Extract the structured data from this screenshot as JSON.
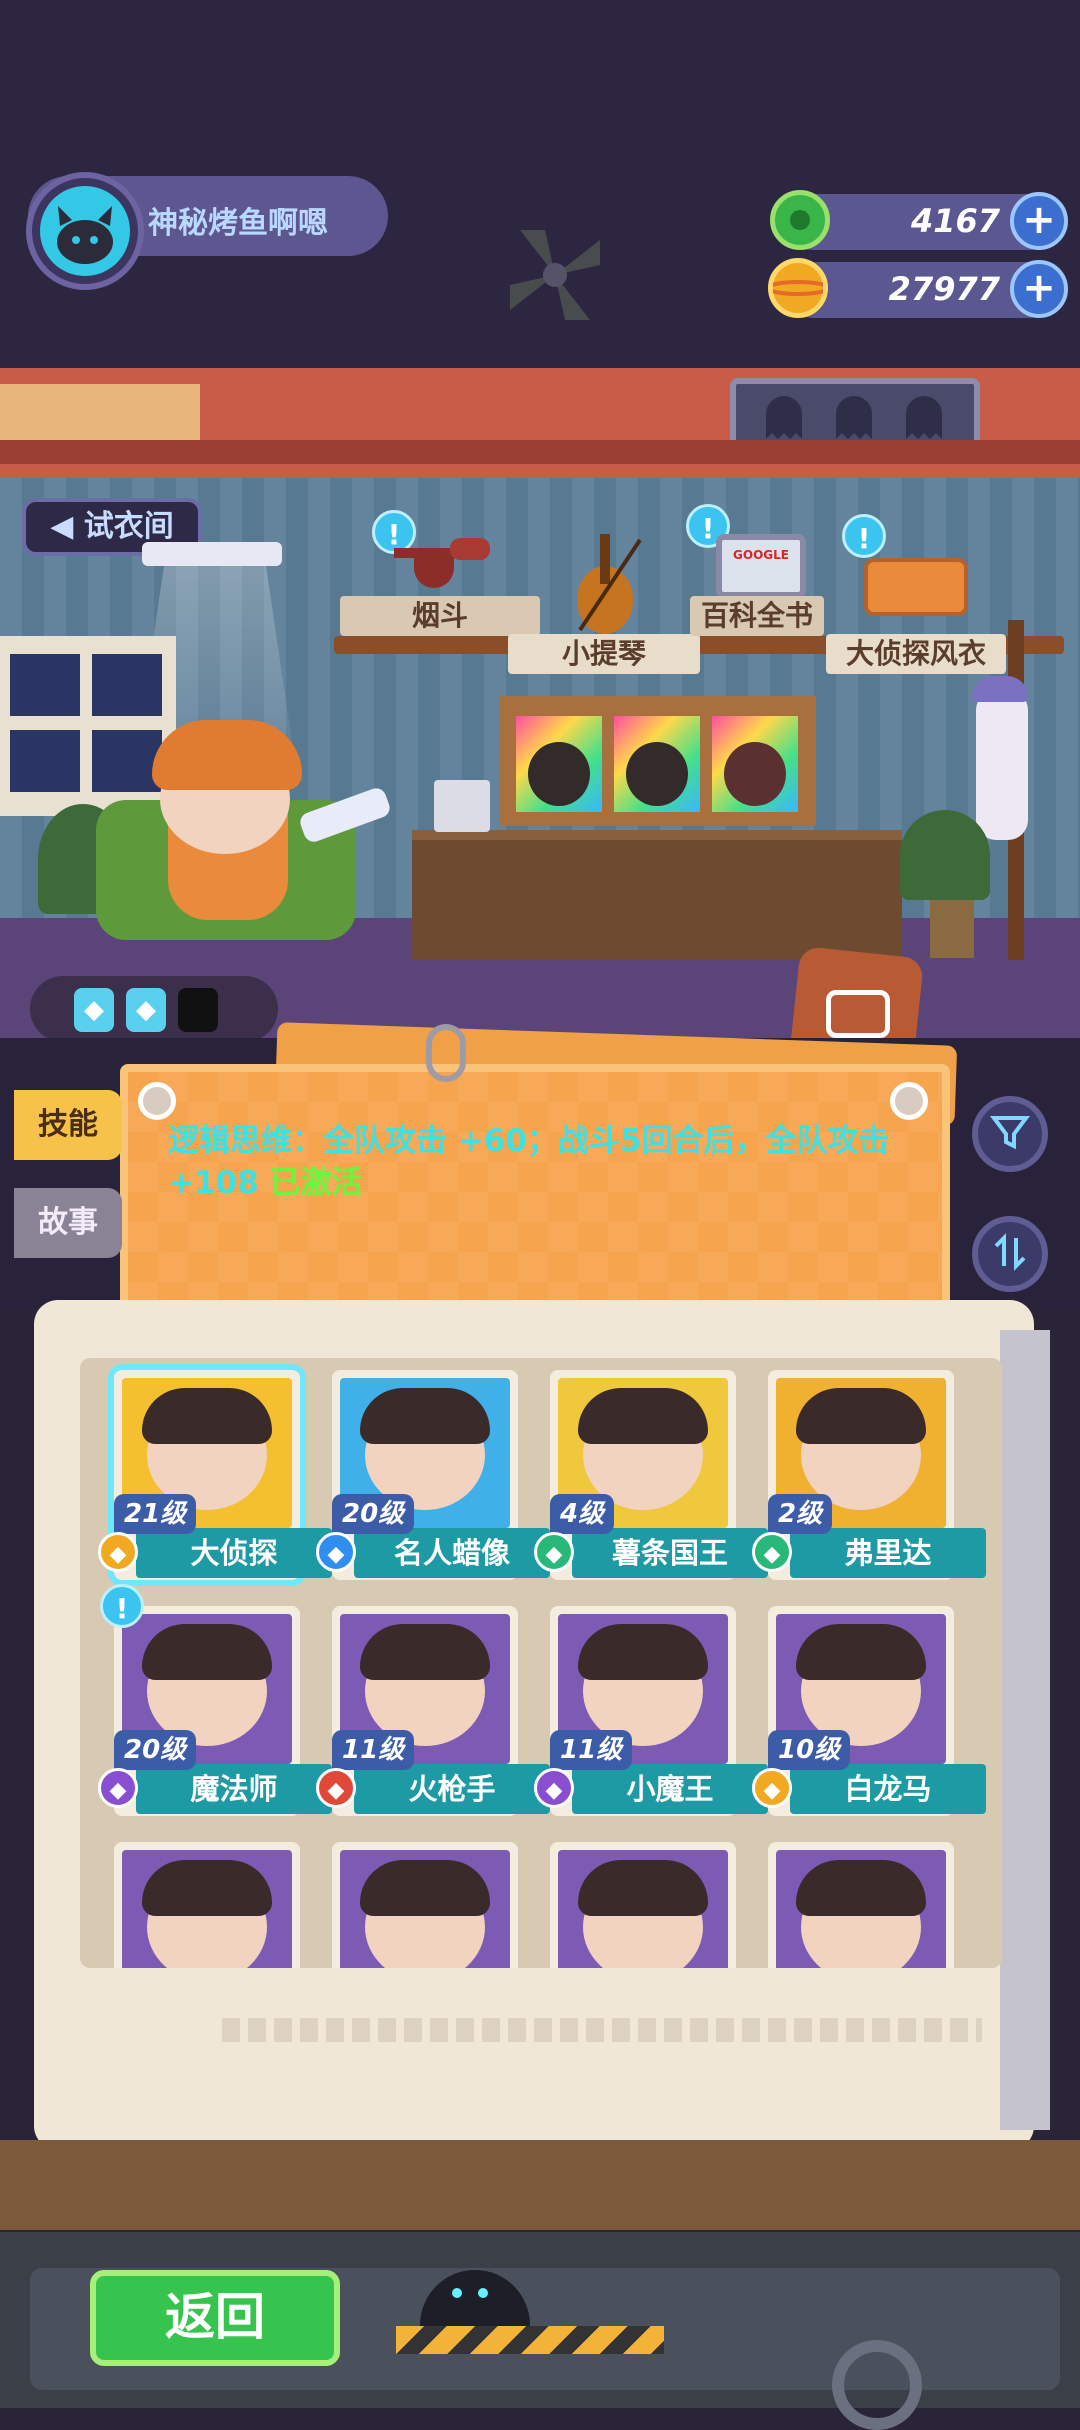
{
  "player": {
    "name": "神秘烤鱼啊嗯"
  },
  "resources": [
    {
      "icon": "green-coin-icon",
      "value": "4167",
      "color": "#3ab54a"
    },
    {
      "icon": "gold-planet-coin-icon",
      "value": "27977",
      "color": "#f2a922"
    }
  ],
  "room": {
    "fitting_room_label": "试衣间",
    "items": [
      {
        "label": "烟斗"
      },
      {
        "label": "小提琴"
      },
      {
        "label": "百科全书"
      },
      {
        "label": "大侦探风衣"
      }
    ],
    "encyclopedia_cover": "GOOGLE"
  },
  "tabs": {
    "skill": "技能",
    "story": "故事"
  },
  "skill": {
    "description": "逻辑思维：全队攻击 +60；战斗5回合后，全队攻击 +108",
    "status": "已激活"
  },
  "characters": [
    {
      "name": "大侦探",
      "level": "21级",
      "badge_color": "#f2a922",
      "art": "#f5c030",
      "selected": true
    },
    {
      "name": "名人蜡像",
      "level": "20级",
      "badge_color": "#2f8ef0",
      "art": "#3fb0e8",
      "selected": false
    },
    {
      "name": "薯条国王",
      "level": "4级",
      "badge_color": "#28b87a",
      "art": "#f0c83c",
      "selected": false
    },
    {
      "name": "弗里达",
      "level": "2级",
      "badge_color": "#28b87a",
      "art": "#f0b030",
      "selected": false
    },
    {
      "name": "魔法师",
      "level": "20级",
      "badge_color": "#8a4fd0",
      "art": "#7d5bb5",
      "selected": false
    },
    {
      "name": "火枪手",
      "level": "11级",
      "badge_color": "#e0483a",
      "art": "#7d5bb5",
      "selected": false
    },
    {
      "name": "小魔王",
      "level": "11级",
      "badge_color": "#8a4fd0",
      "art": "#7d5bb5",
      "selected": false
    },
    {
      "name": "白龙马",
      "level": "10级",
      "badge_color": "#f2a922",
      "art": "#7d5bb5",
      "selected": false
    },
    {
      "name": "",
      "level": "",
      "badge_color": "#8a4fd0",
      "art": "#7d5bb5",
      "selected": false
    },
    {
      "name": "",
      "level": "",
      "badge_color": "#8a4fd0",
      "art": "#7d5bb5",
      "selected": false
    },
    {
      "name": "",
      "level": "",
      "badge_color": "#8a4fd0",
      "art": "#7d5bb5",
      "selected": false
    },
    {
      "name": "",
      "level": "",
      "badge_color": "#8a4fd0",
      "art": "#7d5bb5",
      "selected": false
    }
  ],
  "bottom": {
    "back_label": "返回"
  },
  "icons": {
    "filter": "filter-icon",
    "sort": "sort-icon",
    "costume": "costume-icon",
    "plus": "plus-icon"
  }
}
